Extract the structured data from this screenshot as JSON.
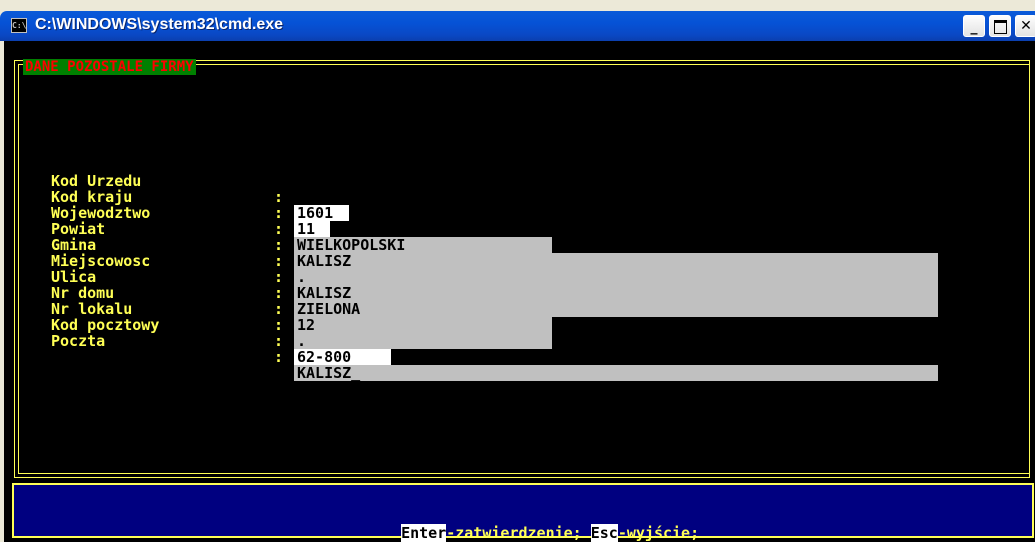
{
  "window": {
    "title": "C:\\WINDOWS\\system32\\cmd.exe",
    "icon_glyph": "C:\\",
    "minimize_glyph": "_",
    "close_glyph": "✕"
  },
  "form": {
    "section_title": "DANE POZOSTALE FIRMY",
    "fields": [
      {
        "label": "Kod Urzedu",
        "value": "1601"
      },
      {
        "label": "Kod kraju",
        "value": "11"
      },
      {
        "label": "Wojewodztwo",
        "value": "WIELKOPOLSKI"
      },
      {
        "label": "Powiat",
        "value": "KALISZ"
      },
      {
        "label": "Gmina",
        "value": "."
      },
      {
        "label": "Miejscowosc",
        "value": "KALISZ"
      },
      {
        "label": "Ulica",
        "value": "ZIELONA"
      },
      {
        "label": "Nr domu",
        "value": "12"
      },
      {
        "label": "Nr lokalu",
        "value": "."
      },
      {
        "label": "Kod pocztowy",
        "value": "62-800"
      },
      {
        "label": "Poczta",
        "value": "KALISZ_"
      }
    ]
  },
  "status": {
    "enter_key": "Enter",
    "enter_text": "-zatwierdzenie; ",
    "esc_key": "Esc",
    "esc_text": "-wyjście;"
  },
  "colors": {
    "console_bg": "#000000",
    "label": "#ffff55",
    "field_bg": "#c0c0c0",
    "status_bg": "#000080",
    "title_bg": "#008000",
    "title_fg": "#ff0000"
  }
}
